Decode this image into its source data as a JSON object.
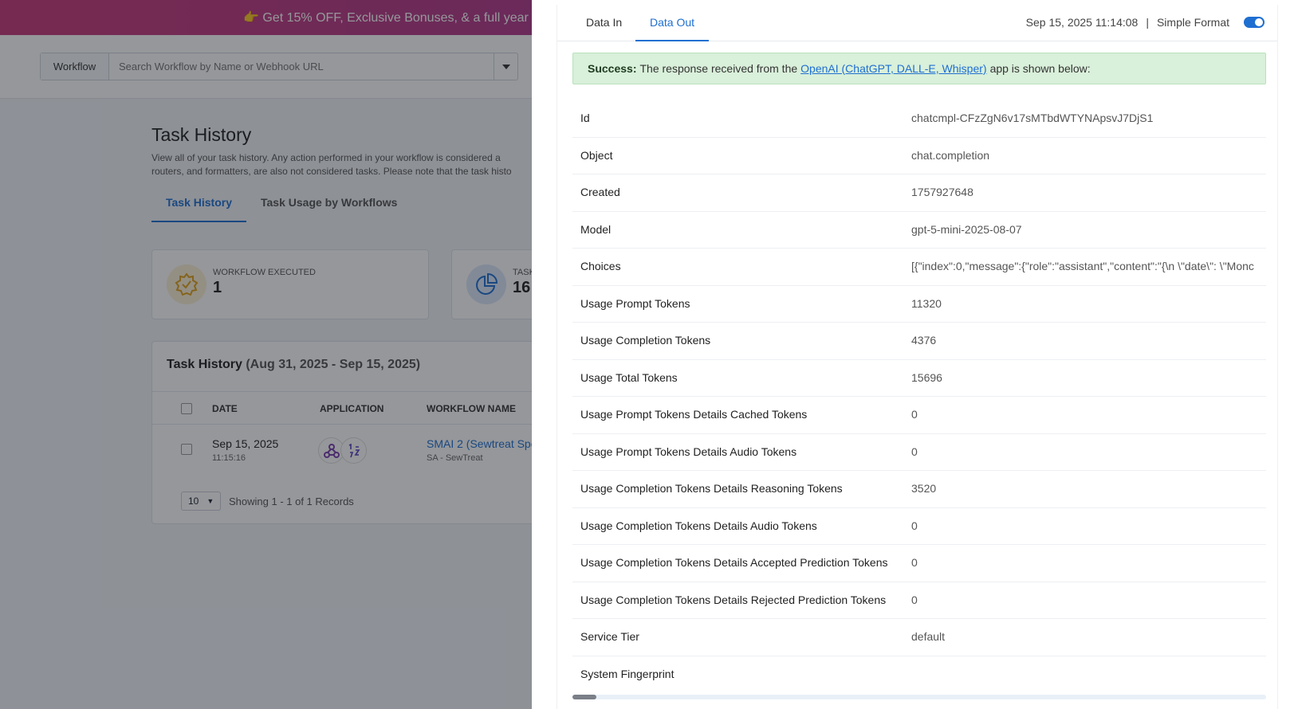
{
  "banner": {
    "text": "👉 Get 15% OFF, Exclusive Bonuses, & a full year"
  },
  "topbar": {
    "workflow_label": "Workflow",
    "search_placeholder": "Search Workflow by Name or Webhook URL"
  },
  "task_history": {
    "title": "Task History",
    "description": "View all of your task history. Any action performed in your workflow is considered a routers, and formatters, are also not considered tasks. Please note that the task histo",
    "tabs": [
      {
        "label": "Task History"
      },
      {
        "label": "Task Usage by Workflows"
      }
    ],
    "stats": [
      {
        "label": "WORKFLOW EXECUTED",
        "value": "1"
      },
      {
        "label": "TASK",
        "value": "16"
      }
    ],
    "table": {
      "title": "Task History",
      "range": "(Aug 31, 2025 - Sep 15, 2025)",
      "columns": [
        "DATE",
        "APPLICATION",
        "WORKFLOW NAME"
      ],
      "row": {
        "date": "Sep 15, 2025",
        "time": "11:15:16",
        "workflow": "SMAI 2 (Sewtreat Spe",
        "workflow_sub": "SA - SewTreat"
      },
      "page_size": "10",
      "showing": "Showing 1 - 1 of 1 Records"
    }
  },
  "drawer": {
    "tabs": [
      {
        "label": "Data In"
      },
      {
        "label": "Data Out"
      }
    ],
    "timestamp": "Sep 15, 2025 11:14:08",
    "separator": "|",
    "format_label": "Simple Format",
    "alert": {
      "strong": "Success:",
      "pre": "The response received from the",
      "link": "OpenAI (ChatGPT, DALL-E, Whisper)",
      "post": "app is shown below:"
    },
    "rows": [
      {
        "key": "Id",
        "value": "chatcmpl-CFzZgN6v17sMTbdWTYNApsvJ7DjS1"
      },
      {
        "key": "Object",
        "value": "chat.completion"
      },
      {
        "key": "Created",
        "value": "1757927648"
      },
      {
        "key": "Model",
        "value": "gpt-5-mini-2025-08-07"
      },
      {
        "key": "Choices",
        "value": "[{\"index\":0,\"message\":{\"role\":\"assistant\",\"content\":\"{\\n \\\"date\\\": \\\"Monc"
      },
      {
        "key": "Usage Prompt Tokens",
        "value": "11320"
      },
      {
        "key": "Usage Completion Tokens",
        "value": "4376"
      },
      {
        "key": "Usage Total Tokens",
        "value": "15696"
      },
      {
        "key": "Usage Prompt Tokens Details Cached Tokens",
        "value": "0"
      },
      {
        "key": "Usage Prompt Tokens Details Audio Tokens",
        "value": "0"
      },
      {
        "key": "Usage Completion Tokens Details Reasoning Tokens",
        "value": "3520"
      },
      {
        "key": "Usage Completion Tokens Details Audio Tokens",
        "value": "0"
      },
      {
        "key": "Usage Completion Tokens Details Accepted Prediction Tokens",
        "value": "0"
      },
      {
        "key": "Usage Completion Tokens Details Rejected Prediction Tokens",
        "value": "0"
      },
      {
        "key": "Service Tier",
        "value": "default"
      },
      {
        "key": "System Fingerprint",
        "value": ""
      }
    ]
  },
  "colors": {
    "accent": "#1f6fd1",
    "success_bg": "#d9f0da"
  }
}
